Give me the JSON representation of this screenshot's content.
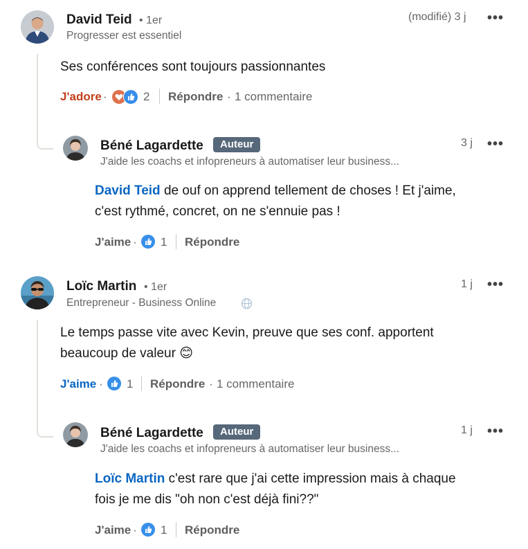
{
  "comments": [
    {
      "author": "David Teid",
      "degree": "• 1er",
      "headline": "Progresser est essentiel",
      "time": "(modifié) 3 j",
      "text": "Ses conférences sont toujours passionnantes",
      "like_label": "J'adore",
      "like_sep": "·",
      "reaction_count": "2",
      "reply_label": "Répondre",
      "reply_sep": "·",
      "replies_count": "1 commentaire",
      "reactions": [
        "heart-icon",
        "like-icon"
      ],
      "reply": {
        "author": "Béné Lagardette",
        "badge": "Auteur",
        "headline": "J'aide les coachs et infopreneurs à automatiser leur business...",
        "time": "3 j",
        "mention": "David Teid",
        "text_line1": " de ouf on apprend tellement de choses ! Et j'aime,",
        "text_line2": "c'est rythmé, concret, on ne s'ennuie pas !",
        "like_label": "J'aime",
        "like_sep": "·",
        "reaction_count": "1",
        "reply_label": "Répondre"
      }
    },
    {
      "author": "Loïc Martin",
      "degree": "• 1er",
      "headline": "Entrepreneur - Business Online",
      "time": "1 j",
      "text_line1": "Le temps passe vite avec Kevin, preuve que ses conf. apportent",
      "text_line2": "beaucoup de valeur",
      "emoji": "😊",
      "like_label": "J'aime",
      "like_sep": "·",
      "reaction_count": "1",
      "reply_label": "Répondre",
      "reply_sep": "·",
      "replies_count": "1 commentaire",
      "reply": {
        "author": "Béné Lagardette",
        "badge": "Auteur",
        "headline": "J'aide les coachs et infopreneurs à automatiser leur business...",
        "time": "1 j",
        "mention": "Loïc Martin",
        "text_line1": " c'est rare que j'ai cette impression mais à chaque",
        "text_line2": "fois je me dis \"oh non c'est déjà fini??\"",
        "like_label": "J'aime",
        "like_sep": "·",
        "reaction_count": "1",
        "reply_label": "Répondre"
      }
    }
  ],
  "menu_glyph": "•••",
  "colors": {
    "link": "#0a66c2",
    "love": "#c23f1c",
    "badge": "#56687a",
    "thread": "#e2dfd9"
  }
}
